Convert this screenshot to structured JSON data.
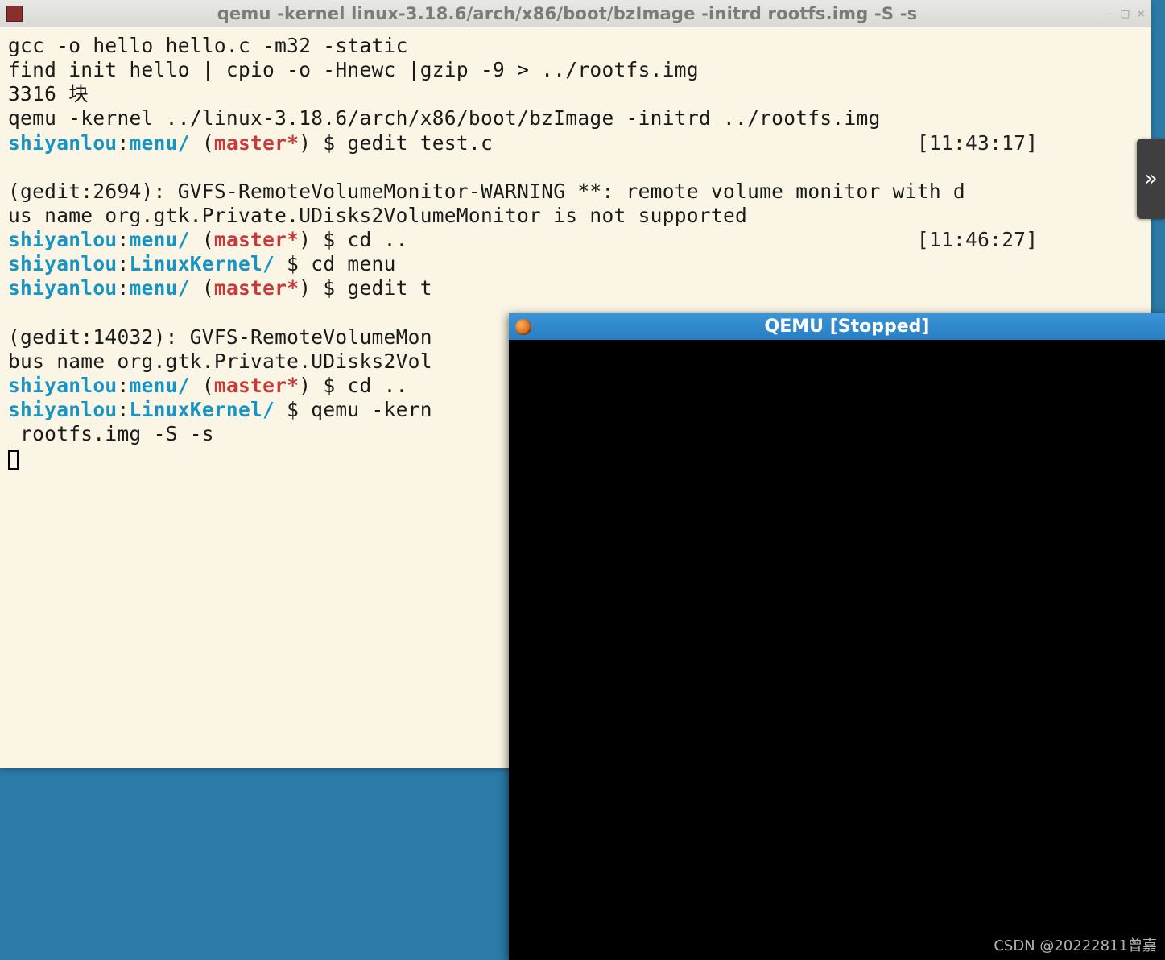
{
  "terminal": {
    "title": "qemu -kernel linux-3.18.6/arch/x86/boot/bzImage -initrd rootfs.img -S -s",
    "win_controls": {
      "min": "—",
      "max": "□",
      "close": "×"
    },
    "lines": {
      "l1": "gcc -o hello hello.c -m32 -static",
      "l2": "find init hello | cpio -o -Hnewc |gzip -9 > ../rootfs.img",
      "l3": "3316 块",
      "l4": "qemu -kernel ../linux-3.18.6/arch/x86/boot/bzImage -initrd ../rootfs.img",
      "p1_user": "shiyanlou",
      "p1_path": "menu/",
      "p1_branch": "master*",
      "p1_cmd": "gedit test.c",
      "p1_time": "[11:43:17]",
      "l5": "",
      "l6": "(gedit:2694): GVFS-RemoteVolumeMonitor-WARNING **: remote volume monitor with d",
      "l7": "us name org.gtk.Private.UDisks2VolumeMonitor is not supported",
      "p2_user": "shiyanlou",
      "p2_path": "menu/",
      "p2_branch": "master*",
      "p2_cmd": "cd ..",
      "p2_time": "[11:46:27]",
      "p3_user": "shiyanlou",
      "p3_path": "LinuxKernel/",
      "p3_cmd": "cd menu",
      "p4_user": "shiyanlou",
      "p4_path": "menu/",
      "p4_branch": "master*",
      "p4_cmd": "gedit t",
      "l8": "",
      "l9": "(gedit:14032): GVFS-RemoteVolumeMon",
      "l10": "bus name org.gtk.Private.UDisks2Vol",
      "p5_user": "shiyanlou",
      "p5_path": "menu/",
      "p5_branch": "master*",
      "p5_cmd": "cd ..",
      "p6_user": "shiyanlou",
      "p6_path": "LinuxKernel/",
      "p6_cmd": "qemu -kern",
      "l11": " rootfs.img -S -s"
    }
  },
  "qemu": {
    "title": "QEMU [Stopped]"
  },
  "side": {
    "chevron": "»"
  },
  "watermark": "CSDN @20222811曾嘉"
}
